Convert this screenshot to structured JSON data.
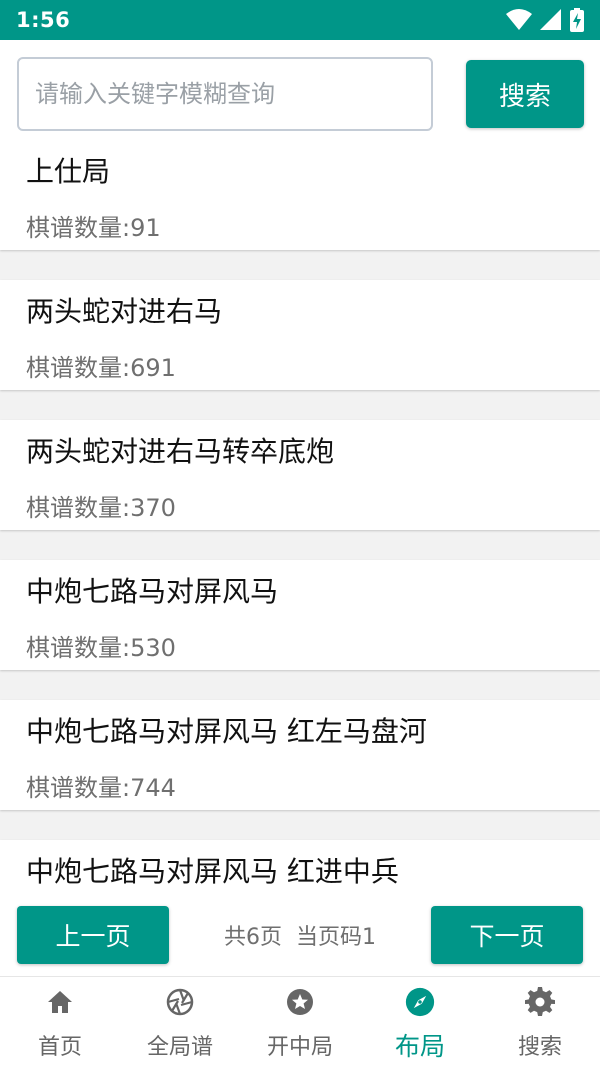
{
  "status_bar": {
    "time": "1:56",
    "icons": [
      "wifi-icon",
      "signal-icon",
      "battery-charging-icon"
    ]
  },
  "search": {
    "placeholder": "请输入关键字模糊查询",
    "value": "",
    "button_label": "搜索"
  },
  "list": {
    "items": [
      {
        "title": "上仕局",
        "count": "棋谱数量:91"
      },
      {
        "title": "两头蛇对进右马",
        "count": "棋谱数量:691"
      },
      {
        "title": "两头蛇对进右马转卒底炮",
        "count": "棋谱数量:370"
      },
      {
        "title": "中炮七路马对屏风马",
        "count": "棋谱数量:530"
      },
      {
        "title": "中炮七路马对屏风马 红左马盘河",
        "count": "棋谱数量:744"
      },
      {
        "title": "中炮七路马对屏风马 红进中兵",
        "count": ""
      }
    ]
  },
  "pager": {
    "prev_label": "上一页",
    "next_label": "下一页",
    "total_pages": "共6页",
    "current_page": "当页码1"
  },
  "bottom_nav": {
    "items": [
      {
        "label": "首页",
        "icon": "home-icon"
      },
      {
        "label": "全局谱",
        "icon": "aperture-icon"
      },
      {
        "label": "开中局",
        "icon": "star-circle-icon"
      },
      {
        "label": "布局",
        "icon": "compass-icon",
        "active": true
      },
      {
        "label": "搜索",
        "icon": "gear-icon"
      }
    ]
  },
  "colors": {
    "primary": "#009688",
    "background": "#f2f2f2",
    "text_primary": "#111111",
    "text_secondary": "#6f6f6f",
    "nav_inactive": "#666666"
  }
}
